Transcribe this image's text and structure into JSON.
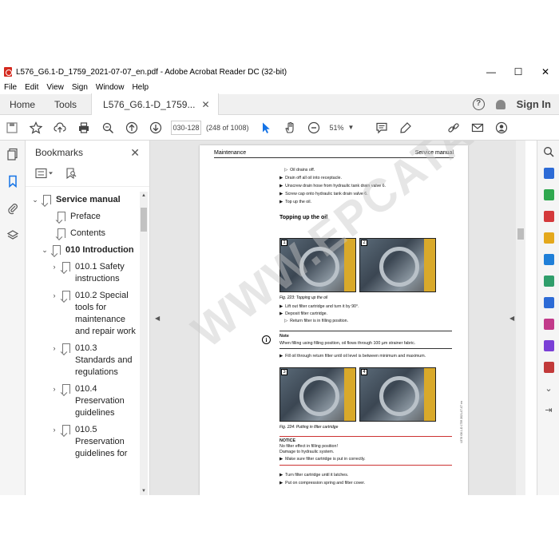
{
  "window": {
    "title": "L576_G6.1-D_1759_2021-07-07_en.pdf - Adobe Acrobat Reader DC (32-bit)",
    "minimize": "—",
    "maximize": "☐",
    "close": "✕"
  },
  "menu": [
    "File",
    "Edit",
    "View",
    "Sign",
    "Window",
    "Help"
  ],
  "tabs": {
    "home": "Home",
    "tools": "Tools",
    "document": "L576_G6.1-D_1759...",
    "document_close": "✕",
    "help_icon": "?",
    "sign_in": "Sign In"
  },
  "toolbar": {
    "page_input": "030-128",
    "page_count": "(248 of 1008)",
    "zoom": "51%"
  },
  "bookmarks": {
    "title": "Bookmarks",
    "items": [
      {
        "label": "Service manual",
        "twisty": "⌄",
        "bold": true
      },
      {
        "label": "Preface",
        "twisty": ""
      },
      {
        "label": "Contents",
        "twisty": ""
      },
      {
        "label": "010 Introduction",
        "twisty": "⌄",
        "bold": true
      },
      {
        "label": "010.1 Safety instructions",
        "twisty": "›"
      },
      {
        "label": "010.2 Special tools for maintenance and repair work",
        "twisty": "›"
      },
      {
        "label": "010.3 Standards and regulations",
        "twisty": "›"
      },
      {
        "label": "010.4 Preservation guidelines",
        "twisty": "›"
      },
      {
        "label": "010.5 Preservation guidelines for",
        "twisty": "›"
      }
    ]
  },
  "document": {
    "header_left": "Maintenance",
    "header_right": "Service manual",
    "lines_top": [
      {
        "marker": "▷",
        "text": "Oil drains off."
      },
      {
        "marker": "▶",
        "text": "Drain off all oil into receptacle."
      },
      {
        "marker": "▶",
        "text": "Unscrew drain hose from hydraulic tank drain valve 6."
      },
      {
        "marker": "▶",
        "text": "Screw cap onto hydraulic tank drain valve 6."
      },
      {
        "marker": "▶",
        "text": "Top up the oil."
      }
    ],
    "section_title": "Topping up the oil",
    "photo_numbers": [
      "1",
      "2",
      "3",
      "4"
    ],
    "fig1_caption": "Fig. 223: Topping up the oil",
    "lines_mid": [
      {
        "marker": "▶",
        "text": "Lift out filter cartridge and turn it by 90°."
      },
      {
        "marker": "▶",
        "text": "Deposit filter cartridge."
      },
      {
        "marker": "▷",
        "text": "Return filter is in filling position."
      }
    ],
    "note_icon": "i",
    "note_title": "Note",
    "note_text": "When filling using filling position, oil flows through 100 µm strainer fabric.",
    "fill_line": {
      "marker": "▶",
      "text": "Fill oil through return filter until oil level is between minimum and maximum."
    },
    "fig2_caption": "Fig. 224: Putting in filter cartridge",
    "notice_title": "NOTICE",
    "notice_lines": [
      "No filter effect in filling position!",
      "Damage to hydraulic system."
    ],
    "notice_action": {
      "marker": "▶",
      "text": "Make sure filter cartridge is put in correctly."
    },
    "lines_bottom": [
      {
        "marker": "▶",
        "text": "Turn filter cartridge until it latches."
      },
      {
        "marker": "▶",
        "text": "Put on compression spring and filter cover."
      }
    ],
    "side_code": "L576 G6.1-D 1759 2021-07-07 en"
  },
  "watermark": "WWW.EPCATALOG.COM",
  "colors": {
    "acrobat_red": "#d42a1f",
    "selection_blue": "#1473e6",
    "tool_colors": [
      "#2d6bd6",
      "#2fa84f",
      "#d4393b",
      "#e4a81c",
      "#1f7fd8",
      "#2f9e6b",
      "#2d6bd6",
      "#c23a8a",
      "#7a3fd6",
      "#c23a3a"
    ]
  }
}
